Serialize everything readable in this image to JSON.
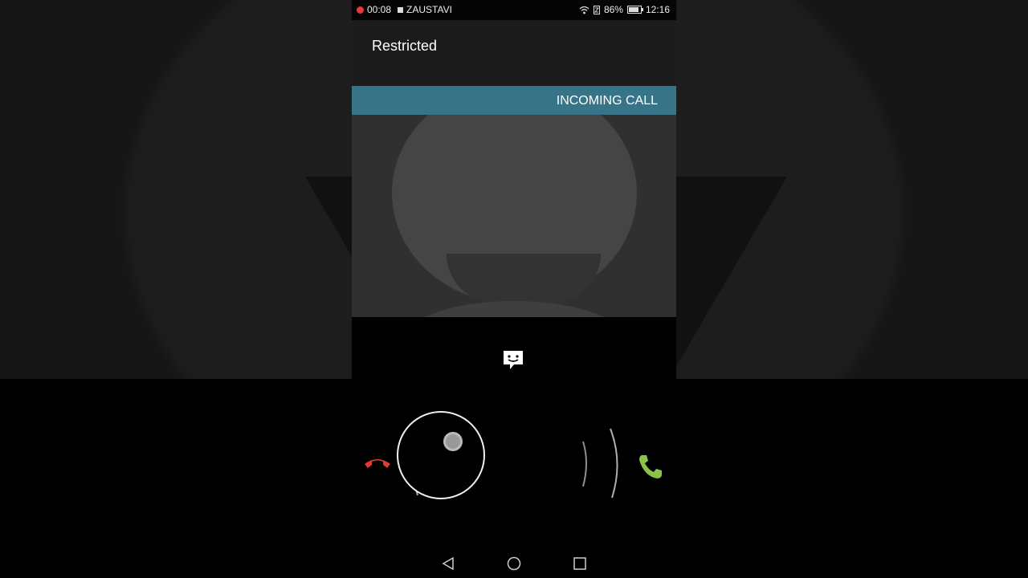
{
  "status_bar": {
    "recording_time": "00:08",
    "stop_label": "ZAUSTAVI",
    "battery_percent": "86%",
    "battery_level": 0.86,
    "clock": "12:16"
  },
  "call": {
    "caller_name": "Restricted",
    "state_label": "INCOMING CALL"
  },
  "icons": {
    "message": "quick-reply-message-icon",
    "decline": "phone-decline-icon",
    "accept": "phone-accept-icon"
  },
  "colors": {
    "banner": "#377488",
    "decline": "#e53935",
    "accept": "#8bc34a"
  },
  "navigation": [
    "back",
    "home",
    "recents"
  ]
}
